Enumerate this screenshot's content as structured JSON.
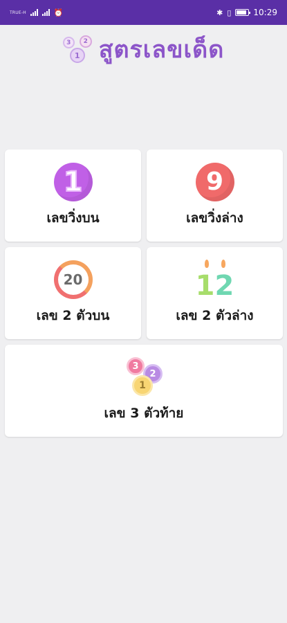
{
  "status_bar": {
    "carrier": "TRUE-H",
    "time": "10:29",
    "icons": [
      "signal-icon",
      "alarm-icon",
      "bluetooth-icon",
      "vibrate-icon",
      "battery-icon"
    ]
  },
  "header": {
    "title": "สูตรเลขเด็ด",
    "logo_balls": [
      "3",
      "2",
      "1"
    ]
  },
  "cards": {
    "run_top": {
      "label": "เลขวิ่งบน",
      "icon_text": "1"
    },
    "run_bottom": {
      "label": "เลขวิ่งล่าง",
      "icon_text": "9"
    },
    "two_top": {
      "label": "เลข 2 ตัวบน",
      "icon_text": "20"
    },
    "two_bottom": {
      "label": "เลข 2 ตัวล่าง",
      "icon_digit1": "1",
      "icon_digit2": "2"
    },
    "three_tail": {
      "label": "เลข 3 ตัวท้าย",
      "balls": [
        "3",
        "2",
        "1"
      ]
    }
  },
  "colors": {
    "status_bar": "#5a2fa6",
    "title": "#8c55c9",
    "background": "#efeff1",
    "card": "#ffffff"
  }
}
